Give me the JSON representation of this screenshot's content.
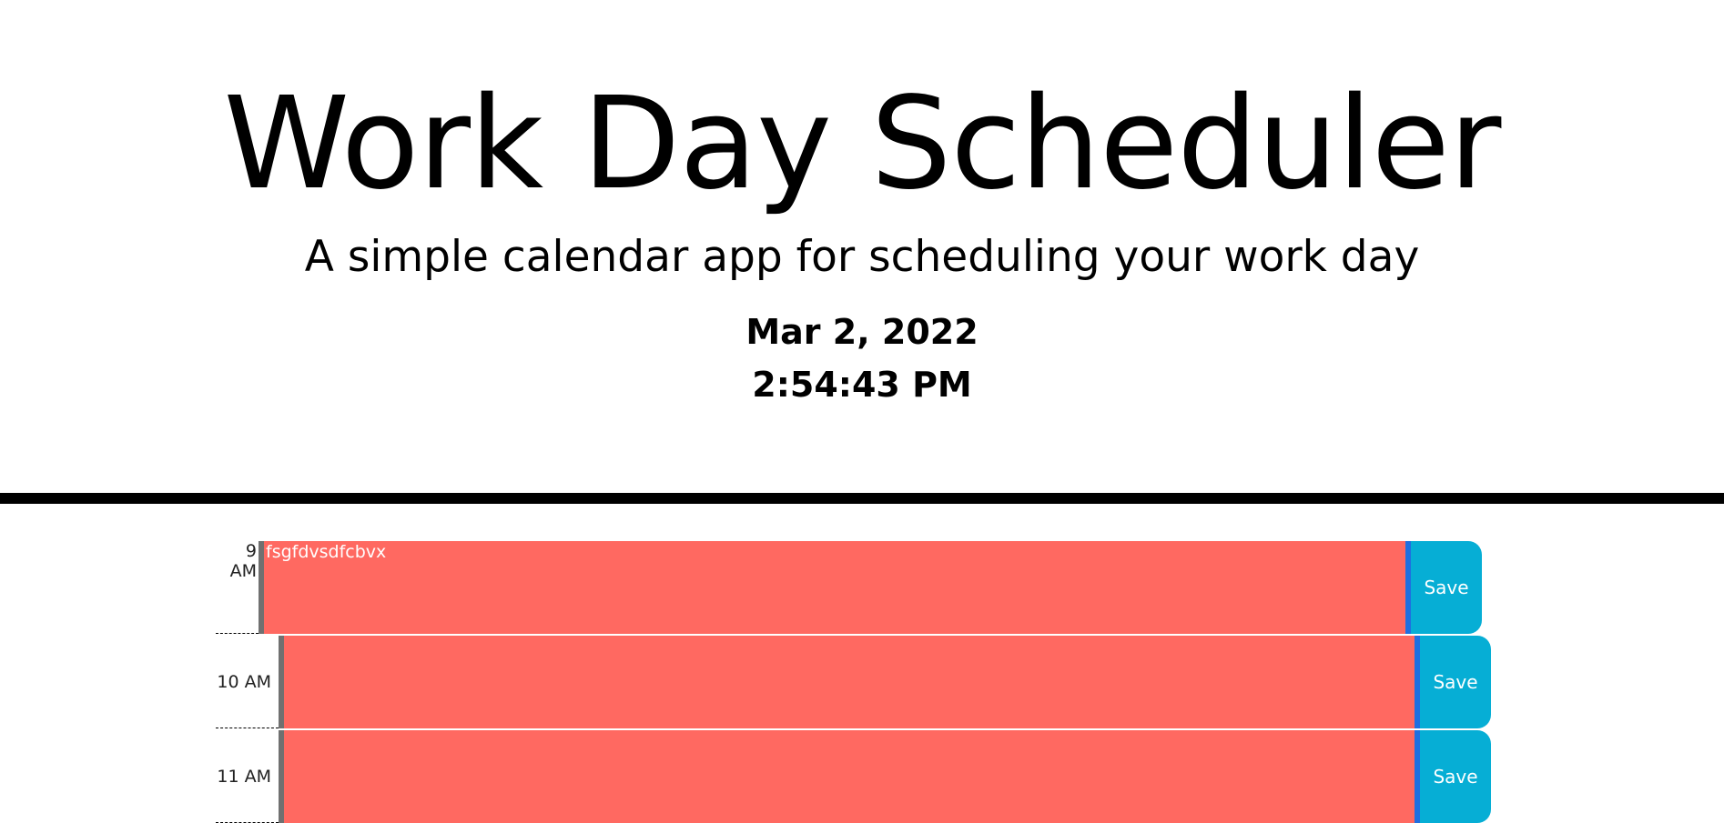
{
  "header": {
    "title": "Work Day Scheduler",
    "subtitle": "A simple calendar app for scheduling your work day",
    "date": "Mar 2, 2022",
    "time": "2:54:43 PM"
  },
  "timeblocks": [
    {
      "hour": "9 AM",
      "text": "fsgfdvsdfcbvx",
      "save_label": "Save",
      "status": "past"
    },
    {
      "hour": "10 AM",
      "text": "",
      "save_label": "Save",
      "status": "past"
    },
    {
      "hour": "11 AM",
      "text": "",
      "save_label": "Save",
      "status": "past"
    }
  ],
  "colors": {
    "past": "#ff6961",
    "save": "#06aed5",
    "divider": "#000000"
  }
}
